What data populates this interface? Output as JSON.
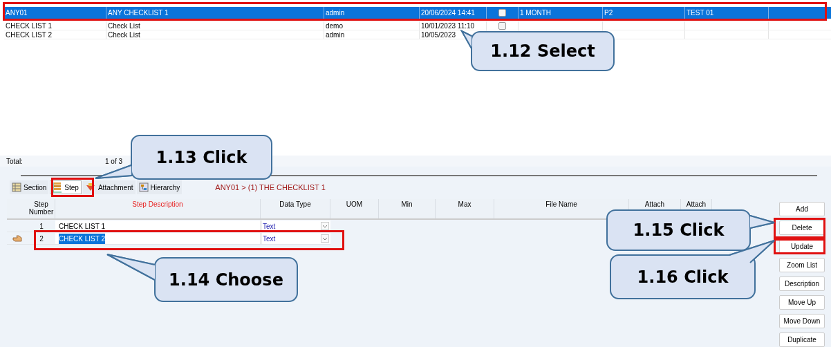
{
  "checklists": {
    "rows": [
      {
        "code": "ANY01",
        "description": "ANY CHECKLIST 1",
        "user": "admin",
        "date": "20/06/2024 14:41",
        "flag": false,
        "period": "1 MONTH",
        "priority": "P2",
        "test": "TEST 01",
        "selected": true
      },
      {
        "code": "CHECK LIST 1",
        "description": "Check List",
        "user": "demo",
        "date": "10/01/2023 11:10",
        "flag": false,
        "selected": false
      },
      {
        "code": "CHECK LIST 2",
        "description": "Check List",
        "user": "admin",
        "date": "10/05/2023",
        "selected": false
      }
    ],
    "total_label": "Total:",
    "total_value": "1 of 3"
  },
  "tabs": [
    {
      "label": "Section",
      "selected": false
    },
    {
      "label": "Step",
      "selected": true
    },
    {
      "label": "Attachment",
      "selected": false
    },
    {
      "label": "Hierarchy",
      "selected": false
    }
  ],
  "breadcrumb": "ANY01 > (1) THE CHECKLIST 1",
  "steps": {
    "columns": [
      {
        "label": "Step Number",
        "required": false
      },
      {
        "label": "Step Description",
        "required": true
      },
      {
        "label": "Data Type",
        "required": false
      },
      {
        "label": "UOM",
        "required": false
      },
      {
        "label": "Min",
        "required": false
      },
      {
        "label": "Max",
        "required": false
      },
      {
        "label": "File Name",
        "required": false
      },
      {
        "label": "Attach",
        "required": false
      },
      {
        "label": "Attach",
        "required": false
      }
    ],
    "rows": [
      {
        "number": "1",
        "description": "CHECK LIST 1",
        "data_type": "Text",
        "current": false,
        "selected": false
      },
      {
        "number": "2",
        "description": "CHECK LIST 2",
        "data_type": "Text",
        "current": true,
        "selected": true
      }
    ]
  },
  "buttons": [
    "Add",
    "Delete",
    "Update",
    "Zoom List",
    "Description",
    "Move Up",
    "Move Down",
    "Duplicate"
  ],
  "callouts": [
    "1.12 Select",
    "1.13 Click",
    "1.14 Choose",
    "1.15 Click",
    "1.16 Click"
  ]
}
